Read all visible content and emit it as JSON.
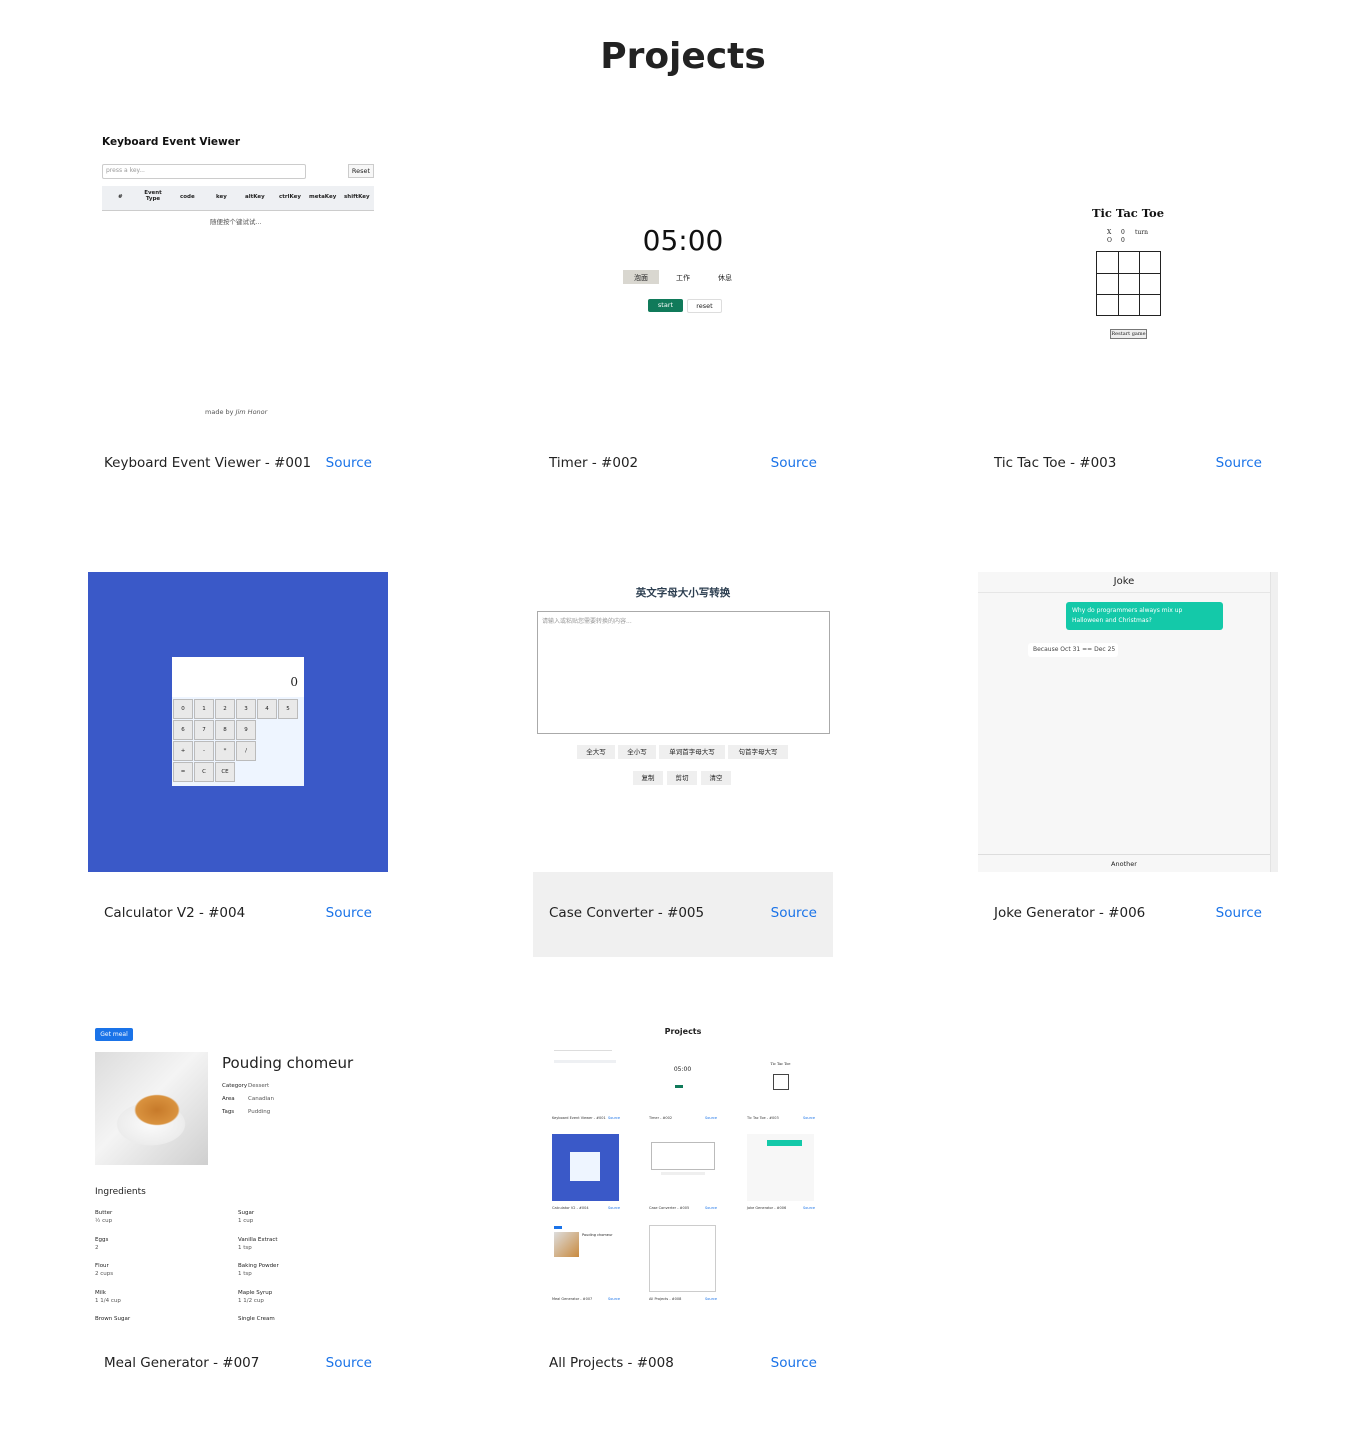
{
  "page": {
    "title": "Projects"
  },
  "projects": [
    {
      "caption": "Keyboard Event Viewer - #001",
      "source": "Source",
      "preview": {
        "title": "Keyboard Event Viewer",
        "placeholder": "press a key...",
        "reset": "Reset",
        "columns": [
          "#",
          "Event Type",
          "code",
          "key",
          "altKey",
          "ctrlKey",
          "metaKey",
          "shiftKey"
        ],
        "empty": "随便按个键试试...",
        "footer_prefix": "made by",
        "footer_author": "Jim Honor"
      }
    },
    {
      "caption": "Timer - #002",
      "source": "Source",
      "preview": {
        "time": "05:00",
        "modes": [
          "泡面",
          "工作",
          "休息"
        ],
        "start": "start",
        "reset": "reset"
      }
    },
    {
      "caption": "Tic Tac Toe - #003",
      "source": "Source",
      "preview": {
        "title": "Tic Tac Toe",
        "x_label": "X",
        "o_label": "O",
        "x_score": "0",
        "o_score": "0",
        "turn": "turn",
        "restart": "Restart game"
      }
    },
    {
      "caption": "Calculator V2 - #004",
      "source": "Source",
      "preview": {
        "display": "0",
        "keys": [
          "0",
          "1",
          "2",
          "3",
          "4",
          "5",
          "6",
          "7",
          "8",
          "9",
          "+",
          "-",
          "*",
          "/",
          "=",
          "C",
          "CE"
        ],
        "bg": "#3a59c8"
      }
    },
    {
      "caption": "Case Converter - #005",
      "source": "Source",
      "preview": {
        "title": "英文字母大小写转换",
        "placeholder": "请输入或粘贴您需要转换的内容...",
        "buttons_row1": [
          "全大写",
          "全小写",
          "单词首字母大写",
          "句首字母大写"
        ],
        "buttons_row2": [
          "复制",
          "剪切",
          "清空"
        ]
      }
    },
    {
      "caption": "Joke Generator - #006",
      "source": "Source",
      "preview": {
        "title": "Joke",
        "question": "Why do programmers always mix up Halloween and Christmas?",
        "answer": "Because Oct 31 == Dec 25",
        "button": "Another",
        "accent": "#14c9a9"
      }
    },
    {
      "caption": "Meal Generator - #007",
      "source": "Source",
      "preview": {
        "button": "Get meal",
        "meal": "Pouding chomeur",
        "category_label": "Category",
        "category": "Dessert",
        "area_label": "Area",
        "area": "Canadian",
        "tags_label": "Tags",
        "tags": "Pudding",
        "ingredients_title": "Ingredients",
        "ingredients": [
          {
            "name": "Butter",
            "amount": "½ cup"
          },
          {
            "name": "Sugar",
            "amount": "1 cup"
          },
          {
            "name": "Eggs",
            "amount": "2"
          },
          {
            "name": "Vanilla Extract",
            "amount": "1 tsp"
          },
          {
            "name": "Flour",
            "amount": "2 cups"
          },
          {
            "name": "Baking Powder",
            "amount": "1 tsp"
          },
          {
            "name": "Milk",
            "amount": "1 1/4 cup"
          },
          {
            "name": "Maple Syrup",
            "amount": "1 1/2 cup"
          },
          {
            "name": "Brown Sugar",
            "amount": ""
          },
          {
            "name": "Single Cream",
            "amount": ""
          }
        ]
      }
    },
    {
      "caption": "All Projects - #008",
      "source": "Source",
      "preview": {
        "title": "Projects",
        "time": "05:00",
        "ttt": "Tic Tac Toe",
        "meal": "Pouding chomeur",
        "captions": [
          "Keyboard Event Viewer - #001",
          "Timer - #002",
          "Tic Tac Toe - #003",
          "Calculator V2 - #004",
          "Case Converter - #005",
          "Joke Generator - #006",
          "Meal Generator - #007",
          "All Projects - #008"
        ],
        "source": "Source"
      }
    }
  ]
}
